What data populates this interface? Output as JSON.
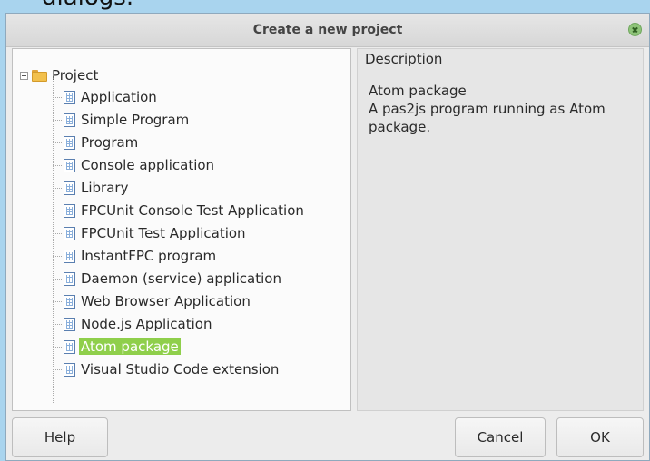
{
  "background": {
    "caption": "dialogs."
  },
  "dialog": {
    "title": "Create a new project",
    "close_icon": "close-icon",
    "tree": {
      "root_label": "Project",
      "items": [
        {
          "label": "Application",
          "selected": false
        },
        {
          "label": "Simple Program",
          "selected": false
        },
        {
          "label": "Program",
          "selected": false
        },
        {
          "label": "Console application",
          "selected": false
        },
        {
          "label": "Library",
          "selected": false
        },
        {
          "label": "FPCUnit Console Test Application",
          "selected": false
        },
        {
          "label": "FPCUnit Test Application",
          "selected": false
        },
        {
          "label": "InstantFPC program",
          "selected": false
        },
        {
          "label": "Daemon (service) application",
          "selected": false
        },
        {
          "label": "Web Browser Application",
          "selected": false
        },
        {
          "label": "Node.js Application",
          "selected": false
        },
        {
          "label": "Atom package",
          "selected": true
        },
        {
          "label": "Visual Studio Code extension",
          "selected": false
        }
      ]
    },
    "description": {
      "header": "Description",
      "line1": "Atom package",
      "line2": "A pas2js program running as Atom package."
    },
    "buttons": {
      "help": "Help",
      "cancel": "Cancel",
      "ok": "OK"
    }
  },
  "colors": {
    "selection": "#8fcf4b",
    "background": "#a9d4ee"
  }
}
